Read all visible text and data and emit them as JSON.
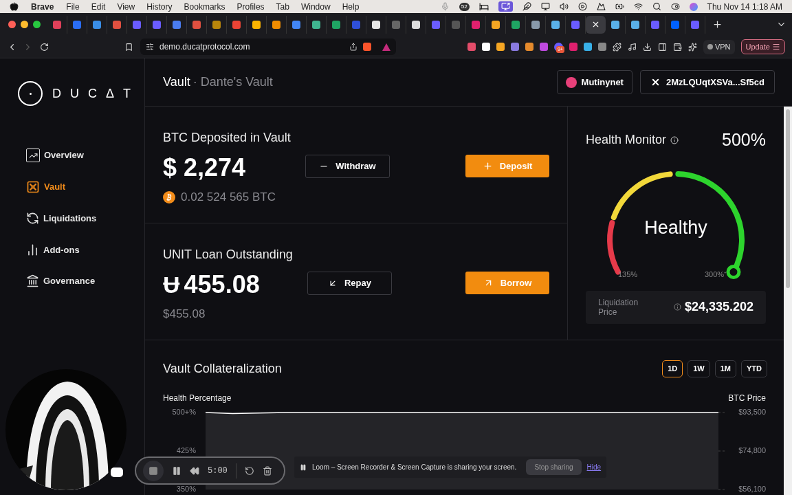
{
  "menu_bar": {
    "app": "Brave",
    "items": [
      "File",
      "Edit",
      "View",
      "History",
      "Bookmarks",
      "Profiles",
      "Tab",
      "Window",
      "Help"
    ],
    "status_badge": "52",
    "clock": "Thu Nov 14  1:18 AM"
  },
  "tabs": [
    {
      "color": "#e0405a",
      "selected": false
    },
    {
      "color": "#2a6df5",
      "selected": false
    },
    {
      "color": "#3a8ee6",
      "selected": false
    },
    {
      "color": "#e05040",
      "selected": false
    },
    {
      "color": "#6a5cff",
      "selected": false
    },
    {
      "color": "#6a5cff",
      "selected": false
    },
    {
      "color": "#4a7df0",
      "selected": false
    },
    {
      "color": "#e05040",
      "selected": false
    },
    {
      "color": "#b8860b",
      "selected": false
    },
    {
      "color": "#ea4335",
      "selected": false
    },
    {
      "color": "#fcb400",
      "selected": false
    },
    {
      "color": "#f08c00",
      "selected": false
    },
    {
      "color": "#4285f4",
      "selected": false
    },
    {
      "color": "#3fb58f",
      "selected": false
    },
    {
      "color": "#1fa463",
      "selected": false
    },
    {
      "color": "#2f4fd8",
      "selected": false
    },
    {
      "color": "#e5e5e5",
      "selected": false
    },
    {
      "color": "#666666",
      "selected": false
    },
    {
      "color": "#dddddd",
      "selected": false
    },
    {
      "color": "#6a5cff",
      "selected": false
    },
    {
      "color": "#555555",
      "selected": false
    },
    {
      "color": "#e0206e",
      "selected": false
    },
    {
      "color": "#f5a623",
      "selected": false
    },
    {
      "color": "#1fa463",
      "selected": false
    },
    {
      "color": "#8899aa",
      "selected": false
    },
    {
      "color": "#5ab0e8",
      "selected": false
    },
    {
      "color": "#6a5cff",
      "selected": false
    },
    {
      "selected": true
    },
    {
      "color": "#5ab0e8",
      "selected": false
    },
    {
      "color": "#5ab0e8",
      "selected": false
    },
    {
      "color": "#6a5cff",
      "selected": false
    },
    {
      "color": "#0061fe",
      "selected": false
    },
    {
      "color": "#6a5cff",
      "selected": false
    }
  ],
  "address_bar": {
    "url": "demo.ducatprotocol.com",
    "extension_badge": "9+",
    "vpn": "VPN",
    "update": "Update"
  },
  "sidebar": {
    "logo": "DUCΔT",
    "items": [
      {
        "label": "Overview",
        "selected": false
      },
      {
        "label": "Vault",
        "selected": true
      },
      {
        "label": "Liquidations",
        "selected": false
      },
      {
        "label": "Add-ons",
        "selected": false
      },
      {
        "label": "Governance",
        "selected": false
      }
    ]
  },
  "header": {
    "title": "Vault",
    "subtitle": "· Dante's Vault",
    "network": "Mutinynet",
    "wallet": "2MzLQUqtXSVa...Sf5cd"
  },
  "deposit": {
    "title": "BTC Deposited in Vault",
    "amount": "$ 2,274",
    "btc": "0.02 524 565 BTC",
    "secondary": "Withdraw",
    "primary": "Deposit"
  },
  "loan": {
    "title": "UNIT Loan Outstanding",
    "symbol": "Ʉ",
    "amount": "455.08",
    "usd": "$455.08",
    "secondary": "Repay",
    "primary": "Borrow"
  },
  "health": {
    "title": "Health Monitor",
    "value": "500%",
    "status": "Healthy",
    "min_label": "135%",
    "max_label": "300%⁺",
    "liquidation_label": "Liquidation Price",
    "liquidation_price": "$24,335.202"
  },
  "collateralization": {
    "title": "Vault Collateralization",
    "ranges": [
      {
        "label": "1D",
        "selected": true
      },
      {
        "label": "1W",
        "selected": false
      },
      {
        "label": "1M",
        "selected": false
      },
      {
        "label": "YTD",
        "selected": false
      }
    ],
    "right_label": "BTC Price",
    "right_ticks": [
      "$93,500",
      "$74,800",
      "$56,100"
    ],
    "chart_data": {
      "type": "line",
      "categories": [
        null,
        null,
        null,
        null,
        null,
        null,
        null,
        null,
        null,
        null,
        null,
        null,
        null,
        null,
        null,
        null,
        null,
        null,
        null,
        null
      ],
      "ylim": [
        350,
        500
      ],
      "yticks": [
        {
          "value": 500,
          "label": "500+%"
        },
        {
          "value": 425,
          "label": "425%"
        },
        {
          "value": 350,
          "label": "350%"
        }
      ],
      "series": [
        {
          "name": "Health Percentage",
          "color": "#ffffff",
          "values": [
            500,
            498,
            499,
            500,
            500,
            500,
            500,
            500,
            500,
            500,
            500,
            500,
            500,
            500,
            500,
            500,
            500,
            500,
            500,
            500
          ]
        }
      ]
    }
  },
  "recorder": {
    "time": "5:00",
    "notice": "Loom – Screen Recorder & Screen Capture is sharing your screen.",
    "stop": "Stop sharing",
    "hide": "Hide"
  }
}
